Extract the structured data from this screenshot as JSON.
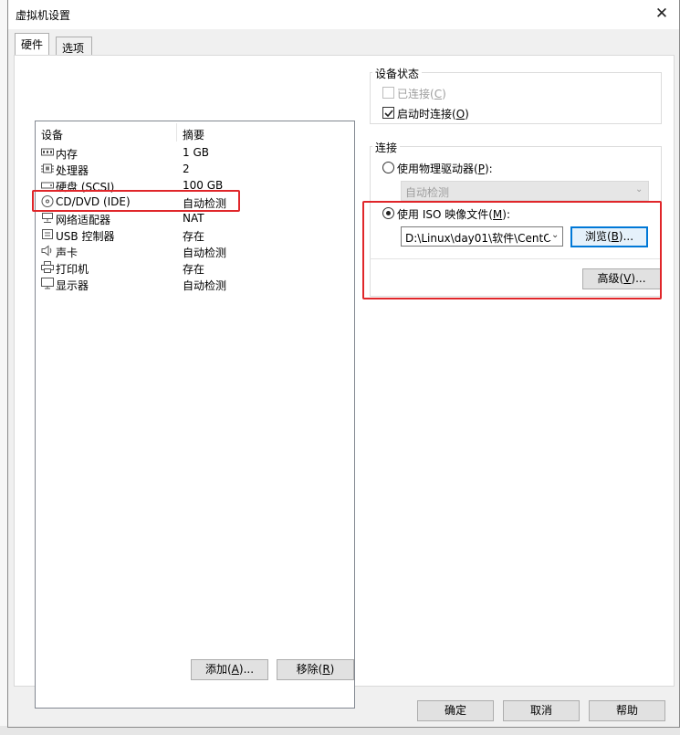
{
  "window": {
    "title": "虚拟机设置"
  },
  "tabs": [
    {
      "label": "硬件"
    },
    {
      "label": "选项"
    }
  ],
  "device_list": {
    "columns": {
      "device": "设备",
      "summary": "摘要"
    },
    "rows": [
      {
        "name": "内存",
        "summary": "1 GB",
        "icon": "memory-icon"
      },
      {
        "name": "处理器",
        "summary": "2",
        "icon": "cpu-icon"
      },
      {
        "name": "硬盘 (SCSI)",
        "summary": "100 GB",
        "icon": "hard-disk-icon"
      },
      {
        "name": "CD/DVD (IDE)",
        "summary": "自动检测",
        "icon": "cd-dvd-icon"
      },
      {
        "name": "网络适配器",
        "summary": "NAT",
        "icon": "network-adapter-icon"
      },
      {
        "name": "USB 控制器",
        "summary": "存在",
        "icon": "usb-icon"
      },
      {
        "name": "声卡",
        "summary": "自动检测",
        "icon": "speaker-icon"
      },
      {
        "name": "打印机",
        "summary": "存在",
        "icon": "printer-icon"
      },
      {
        "name": "显示器",
        "summary": "自动检测",
        "icon": "monitor-icon"
      }
    ],
    "add_button": {
      "text": "添加(",
      "key": "A",
      "suffix": ")..."
    },
    "remove_button": {
      "text": "移除(",
      "key": "R",
      "suffix": ")"
    }
  },
  "device_status": {
    "title": "设备状态",
    "connected": {
      "text": "已连接(",
      "key": "C",
      "suffix": ")",
      "checked": false,
      "enabled": false
    },
    "connect_on_power_on": {
      "text": "启动时连接(",
      "key": "O",
      "suffix": ")",
      "checked": true
    }
  },
  "connection": {
    "title": "连接",
    "physical_drive": {
      "text": "使用物理驱动器(",
      "key": "P",
      "suffix": "):",
      "selected": false,
      "dropdown_value": "自动检测"
    },
    "iso_image": {
      "text": "使用 ISO 映像文件(",
      "key": "M",
      "suffix": "):",
      "selected": true,
      "path_value": "D:\\Linux\\day01\\软件\\CentO"
    },
    "browse_button": {
      "text": "浏览(",
      "key": "B",
      "suffix": ")..."
    },
    "advanced_button": {
      "text": "高级(",
      "key": "V",
      "suffix": ")..."
    }
  },
  "footer": {
    "ok": "确定",
    "cancel": "取消",
    "help": "帮助"
  },
  "colors": {
    "highlight_border": "#e0262a",
    "focus_blue": "#0078d7"
  }
}
